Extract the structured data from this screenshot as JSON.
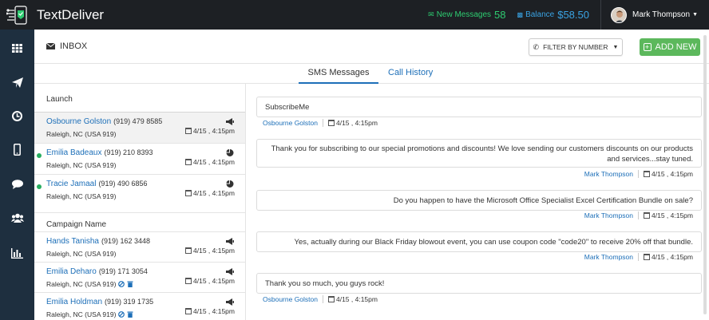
{
  "app": {
    "name": "TextDeliver"
  },
  "topbar": {
    "new_messages_label": "New Messages",
    "new_messages_count": "58",
    "balance_label": "Balance",
    "balance_value": "$58.50",
    "user_name": "Mark Thompson"
  },
  "sidebar": {
    "icons": [
      "grid-icon",
      "send-icon",
      "clock-icon",
      "mobile-icon",
      "chat-icon",
      "users-icon",
      "chart-icon"
    ]
  },
  "header": {
    "title": "INBOX",
    "filter_label": "FILTER BY NUMBER",
    "add_label": "ADD NEW"
  },
  "tabs": {
    "sms": "SMS Messages",
    "calls": "Call History"
  },
  "contacts": {
    "section1": "Launch",
    "section2": "Campaign Name",
    "rows": [
      {
        "name": "Osbourne Golston",
        "phone": "(919) 479 8585",
        "location": "Raleigh, NC (USA 919)",
        "time": "4/15 , 4:15pm",
        "icon": "megaphone-icon",
        "online": false
      },
      {
        "name": "Emilia Badeaux",
        "phone": "(919) 210 8393",
        "location": "Raleigh, NC (USA 919)",
        "time": "4/15 , 4:15pm",
        "icon": "pie-chart-icon",
        "online": true
      },
      {
        "name": "Tracie Jamaal",
        "phone": "(919) 490 6856",
        "location": "Raleigh, NC (USA 919)",
        "time": "4/15 , 4:15pm",
        "icon": "pie-chart-icon",
        "online": true
      },
      {
        "name": "Hands Tanisha",
        "phone": "(919) 162 3448",
        "location": "Raleigh, NC (USA 919)",
        "time": "4/15 , 4:15pm",
        "icon": "megaphone-icon",
        "online": false
      },
      {
        "name": "Emilia Deharo",
        "phone": "(919) 171 3054",
        "location": "Raleigh, NC (USA 919)",
        "time": "4/15 , 4:15pm",
        "icon": "megaphone-icon",
        "online": false
      },
      {
        "name": "Emilia Holdman",
        "phone": "(919) 319 1735",
        "location": "Raleigh, NC (USA 919)",
        "time": "4/15 , 4:15pm",
        "icon": "megaphone-icon",
        "online": false
      }
    ]
  },
  "messages": [
    {
      "text": "SubscribeMe",
      "sender": "Osbourne Golston",
      "time": "4/15 , 4:15pm",
      "direction": "in"
    },
    {
      "text": "Thank you for subscribing to our special promotions and discounts! We love sending our customers discounts on our products and services...stay tuned.",
      "sender": "Mark Thompson",
      "time": "4/15 , 4:15pm",
      "direction": "out"
    },
    {
      "text": "Do you happen to have the Microsoft Office Specialist Excel Certification Bundle on sale?",
      "sender": "Mark Thompson",
      "time": "4/15 , 4:15pm",
      "direction": "out"
    },
    {
      "text": "Yes, actually during our Black Friday blowout event, you can use coupon code \"code20\" to receive 20% off that bundle.",
      "sender": "Mark Thompson",
      "time": "4/15 , 4:15pm",
      "direction": "out"
    },
    {
      "text": "Thank you so much, you guys rock!",
      "sender": "Osbourne Golston",
      "time": "4/15 , 4:15pm",
      "direction": "in"
    }
  ],
  "colors": {
    "topbar": "#1d2024",
    "sidebar": "#1e2f3f",
    "accent_green": "#5cb85c",
    "new_messages": "#2ecc71",
    "balance": "#3aa3e3",
    "link": "#1d6fb8"
  }
}
